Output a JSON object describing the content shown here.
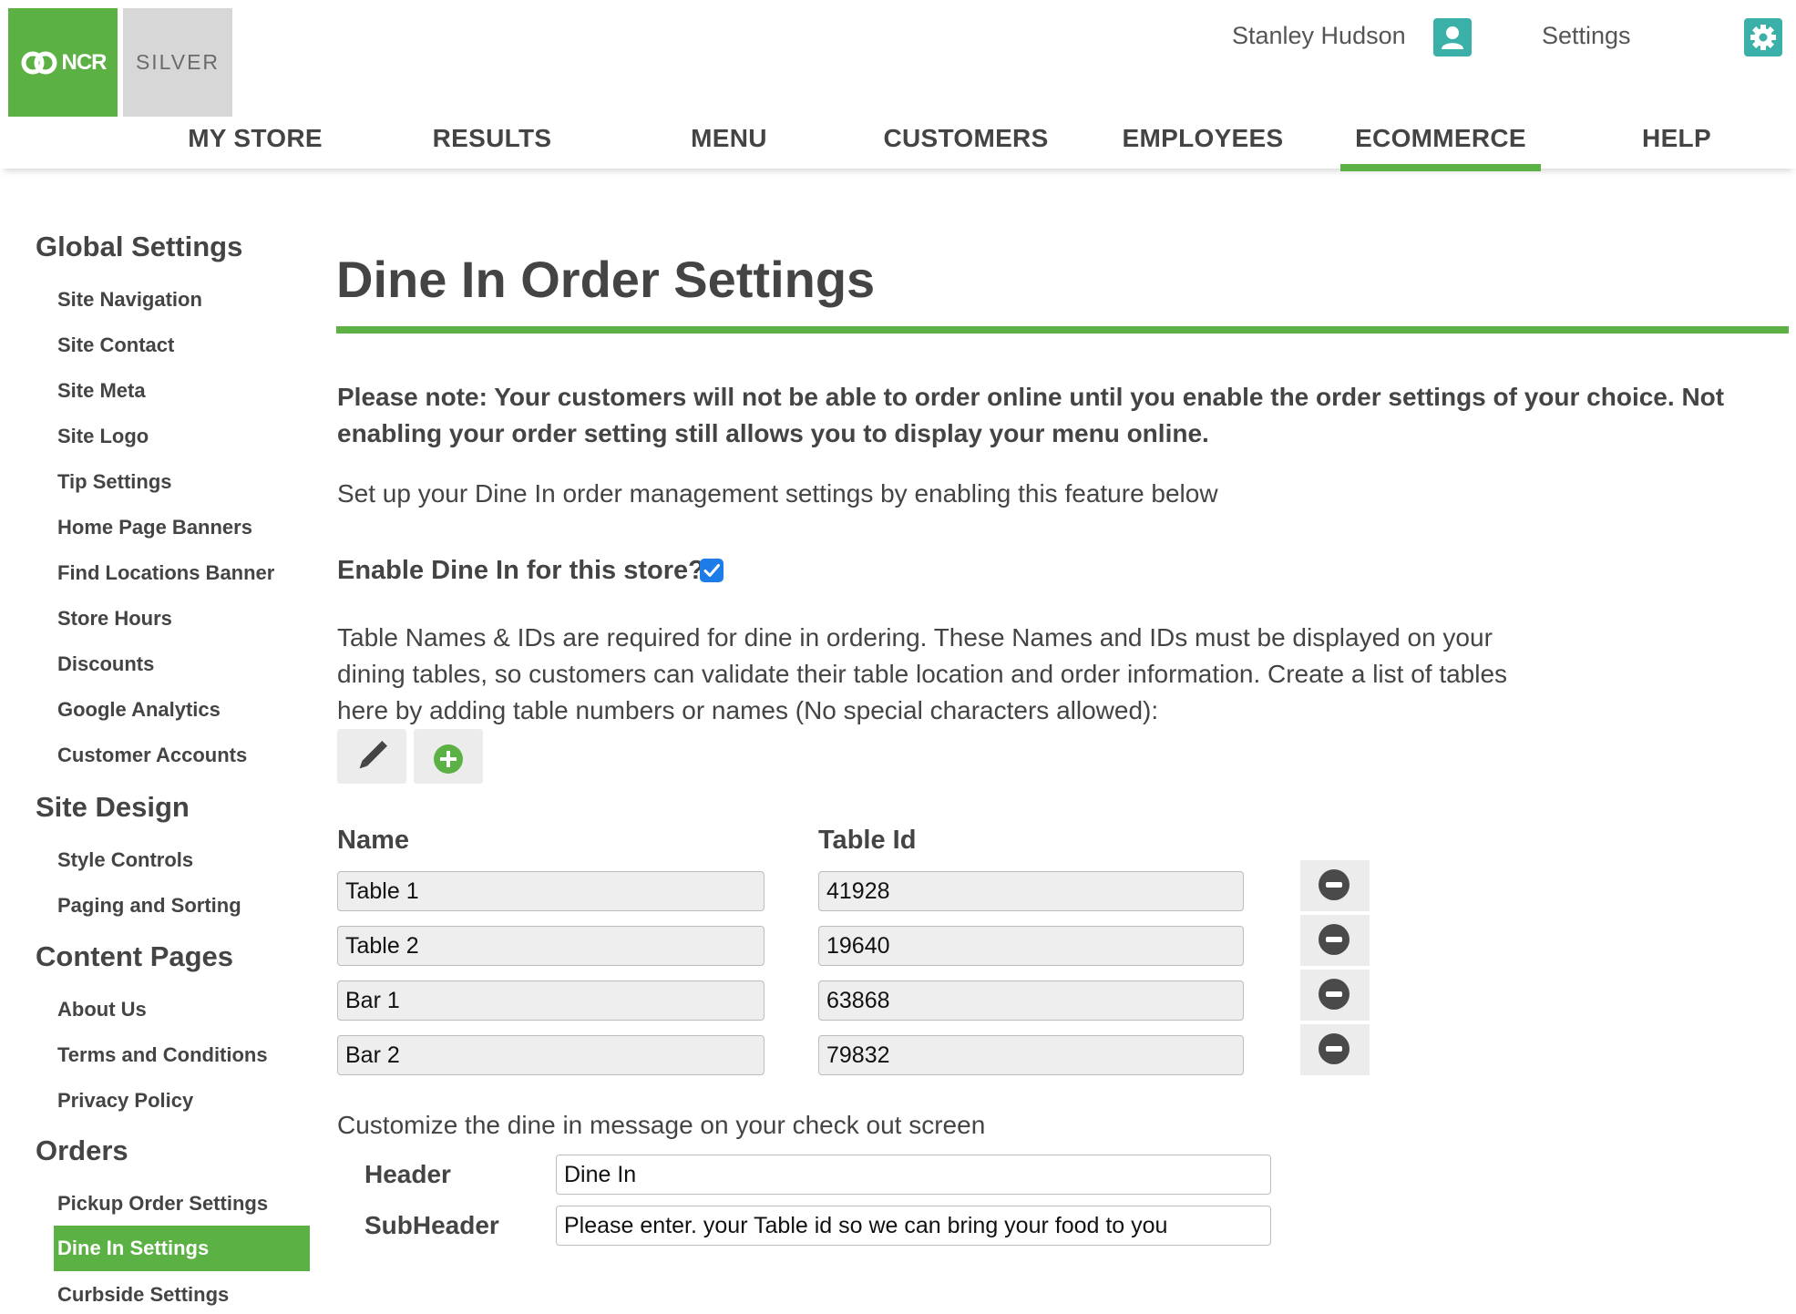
{
  "header": {
    "logo_brand": "NCR",
    "logo_product": "SILVER",
    "user_name": "Stanley Hudson",
    "settings_label": "Settings",
    "accent_color": "#5bb143",
    "icon_color": "#3ab0a8"
  },
  "nav": {
    "items": [
      "MY STORE",
      "RESULTS",
      "MENU",
      "CUSTOMERS",
      "EMPLOYEES",
      "ECOMMERCE",
      "HELP"
    ],
    "active": "ECOMMERCE"
  },
  "sidebar": {
    "sections": [
      {
        "heading": "Global Settings",
        "items": [
          "Site Navigation",
          "Site Contact",
          "Site Meta",
          "Site Logo",
          "Tip Settings",
          "Home Page Banners",
          "Find Locations Banner",
          "Store Hours",
          "Discounts",
          "Google Analytics",
          "Customer Accounts"
        ]
      },
      {
        "heading": "Site Design",
        "items": [
          "Style Controls",
          "Paging and Sorting"
        ]
      },
      {
        "heading": "Content Pages",
        "items": [
          "About Us",
          "Terms and Conditions",
          "Privacy Policy"
        ]
      },
      {
        "heading": "Orders",
        "items": [
          "Pickup Order Settings",
          "Dine In Settings",
          "Curbside Settings"
        ]
      }
    ],
    "active_item": "Dine In Settings"
  },
  "main": {
    "title": "Dine In Order Settings",
    "note": "Please note: Your customers will not be able to order online until you enable the order settings of your choice. Not enabling your order setting still allows you to display your menu online.",
    "intro": "Set up your Dine In order management settings by enabling this feature below",
    "enable_label": "Enable Dine In for this store?",
    "enable_checked": true,
    "description": "Table Names & IDs are required for dine in ordering. These Names and IDs must be displayed on your dining tables, so customers can validate their table location and order information. Create a list of tables here by adding table numbers or names (No special characters allowed):",
    "tools": {
      "edit_icon": "pencil-icon",
      "add_icon": "plus-circle-icon"
    },
    "table": {
      "headers": {
        "name": "Name",
        "id": "Table Id"
      },
      "rows": [
        {
          "name": "Table 1",
          "id": "41928"
        },
        {
          "name": "Table 2",
          "id": "19640"
        },
        {
          "name": "Bar 1",
          "id": "63868"
        },
        {
          "name": "Bar 2",
          "id": "79832"
        }
      ],
      "remove_icon": "minus-circle-icon"
    },
    "customize_label": "Customize the dine in message on your check out screen",
    "message": {
      "header_label": "Header",
      "header_value": "Dine In",
      "subheader_label": "SubHeader",
      "subheader_value": "Please enter. your Table id so we can bring your food to you"
    }
  }
}
